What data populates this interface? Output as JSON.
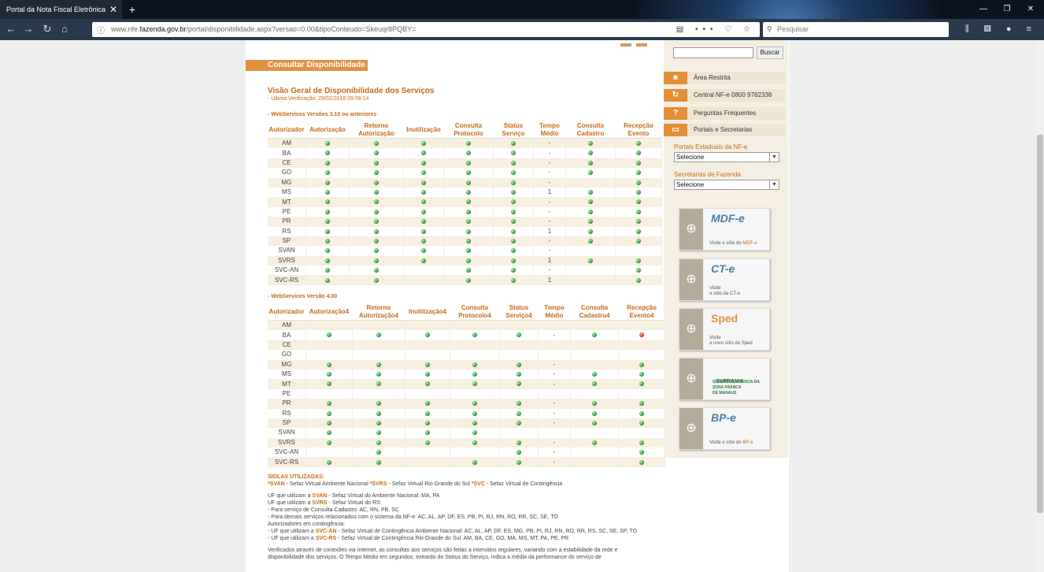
{
  "browser": {
    "tab_title": "Portal da Nota Fiscal Eletrônica",
    "url_prefix": "www.nfe.",
    "url_domain": "fazenda.gov.br",
    "url_rest": "/portal/disponibilidade.aspx?versao=0.00&tipoConteudo=Skeuqr8PQBY=",
    "search_placeholder": "Pesquisar"
  },
  "page": {
    "section_title": "Consultar Disponibilidade",
    "heading": "Visão Geral de Disponibilidade dos Serviços",
    "last_check": "- Última Verificação: 28/02/2018 09:59:14",
    "table1_title": "- WebServices Versões 3.10 ou anteriores",
    "table2_title": "- WebServices Versão 4.00",
    "table1_headers": [
      "Autorizador",
      "Autorização",
      "Retorno Autorização",
      "Inutilização",
      "Consulta Protocolo",
      "Status Serviço",
      "Tempo Médio",
      "Consulta Cadastro",
      "Recepção Evento"
    ],
    "table2_headers": [
      "Autorizador",
      "Autorização4",
      "Retorno Autorização4",
      "Inutilização4",
      "Consulta Protocolo4",
      "Status Serviço4",
      "Tempo Médio",
      "Consulta Cadastro4",
      "Recepção Evento4"
    ],
    "table1_rows": [
      [
        "AM",
        "g",
        "g",
        "g",
        "g",
        "g",
        "-",
        "g",
        "g"
      ],
      [
        "BA",
        "g",
        "g",
        "g",
        "g",
        "g",
        "-",
        "g",
        "g"
      ],
      [
        "CE",
        "g",
        "g",
        "g",
        "g",
        "g",
        "-",
        "g",
        "g"
      ],
      [
        "GO",
        "g",
        "g",
        "g",
        "g",
        "g",
        "-",
        "g",
        "g"
      ],
      [
        "MG",
        "g",
        "g",
        "g",
        "g",
        "g",
        "-",
        "",
        "g"
      ],
      [
        "MS",
        "g",
        "g",
        "g",
        "g",
        "g",
        "1",
        "g",
        "g"
      ],
      [
        "MT",
        "g",
        "g",
        "g",
        "g",
        "g",
        "-",
        "g",
        "g"
      ],
      [
        "PE",
        "g",
        "g",
        "g",
        "g",
        "g",
        "-",
        "g",
        "g"
      ],
      [
        "PR",
        "g",
        "g",
        "g",
        "g",
        "g",
        "-",
        "g",
        "g"
      ],
      [
        "RS",
        "g",
        "g",
        "g",
        "g",
        "g",
        "1",
        "g",
        "g"
      ],
      [
        "SP",
        "g",
        "g",
        "g",
        "g",
        "g",
        "-",
        "g",
        "g"
      ],
      [
        "SVAN",
        "g",
        "g",
        "g",
        "g",
        "g",
        "-",
        "",
        ""
      ],
      [
        "SVRS",
        "g",
        "g",
        "g",
        "g",
        "g",
        "1",
        "g",
        "g"
      ],
      [
        "SVC-AN",
        "g",
        "g",
        "",
        "g",
        "g",
        "-",
        "",
        "g"
      ],
      [
        "SVC-RS",
        "g",
        "g",
        "",
        "g",
        "g",
        "1",
        "",
        "g"
      ]
    ],
    "table2_rows": [
      [
        "AM",
        "",
        "",
        "",
        "",
        "",
        "",
        "",
        ""
      ],
      [
        "BA",
        "g",
        "g",
        "g",
        "g",
        "g",
        "-",
        "g",
        "r"
      ],
      [
        "CE",
        "",
        "",
        "",
        "",
        "",
        "",
        "",
        ""
      ],
      [
        "GO",
        "",
        "",
        "",
        "",
        "",
        "",
        "",
        ""
      ],
      [
        "MG",
        "g",
        "g",
        "g",
        "g",
        "g",
        "-",
        "",
        "g"
      ],
      [
        "MS",
        "g",
        "g",
        "g",
        "g",
        "g",
        "-",
        "g",
        "g"
      ],
      [
        "MT",
        "g",
        "g",
        "g",
        "g",
        "g",
        "-",
        "g",
        "g"
      ],
      [
        "PE",
        "",
        "",
        "",
        "",
        "",
        "",
        "",
        ""
      ],
      [
        "PR",
        "g",
        "g",
        "g",
        "g",
        "g",
        "-",
        "g",
        "g"
      ],
      [
        "RS",
        "g",
        "g",
        "g",
        "g",
        "g",
        "-",
        "g",
        "g"
      ],
      [
        "SP",
        "g",
        "g",
        "g",
        "g",
        "g",
        "-",
        "g",
        "g"
      ],
      [
        "SVAN",
        "g",
        "g",
        "g",
        "g",
        "",
        "",
        "",
        ""
      ],
      [
        "SVRS",
        "g",
        "g",
        "g",
        "g",
        "g",
        "-",
        "g",
        "g"
      ],
      [
        "SVC-AN",
        "",
        "g",
        "",
        "",
        "g",
        "-",
        "",
        "g"
      ],
      [
        "SVC-RS",
        "g",
        "g",
        "",
        "g",
        "g",
        "-",
        "",
        "g"
      ]
    ],
    "legend": {
      "title": "SIGLAS UTILIZADAS:",
      "line1_a": "*SVAN",
      "line1_b": " - Sefaz Virtual Ambiente Nacional ",
      "line1_c": "*SVRS",
      "line1_d": " - Sefaz Virtual Rio Grande do Sul ",
      "line1_e": "*SVC",
      "line1_f": " - Sefaz Virtual de Contingência",
      "uf1_a": "UF que utilizam a ",
      "uf1_b": "SVAN",
      "uf1_c": " - Sefaz Virtual do Ambiente Nacional: MA, PA",
      "uf2_a": "UF que utilizam a ",
      "uf2_b": "SVRS",
      "uf2_c": " - Sefaz Virtual do RS:",
      "uf3": "- Para serviço de Consulta Cadastro: AC, RN, PB, SC",
      "uf4": "- Para demais serviços relacionados com o sistema da NF-e: AC, AL, AP, DF, ES, PB, PI, RJ, RN, RO, RR, SC, SE, TO",
      "uf5": "Autorizadores em contingência:",
      "uf6_a": "- UF que utilizam a ",
      "uf6_b": "SVC-AN",
      "uf6_c": " - Sefaz Virtual de Contingência Ambiente Nacional: AC, AL, AP, DF, ES, MG, PB, PI, RJ, RN, RO, RR, RS, SC, SE, SP, TO",
      "uf7_a": "- UF que utilizam a ",
      "uf7_b": "SVC-RS",
      "uf7_c": " - Sefaz Virtual de Contingência Rio Grande do Sul: AM, BA, CE, GO, MA, MS, MT, PA, PE, PR",
      "verif1": "Verificados através de conexões via Internet, as consultas aos serviços são feitas a intervalos regulares, variando com a estabilidade da rede e",
      "verif2": "disponibilidade dos serviços. O Tempo Médio em segundos, extraído do Status do Serviço, indica a média da performance do serviço de"
    }
  },
  "sidebar": {
    "search_button": "Buscar",
    "links": [
      "Área Restrita",
      "Central NF-e 0800 9782338",
      "Perguntas Frequentes",
      "Portais e Secretarias"
    ],
    "portais_label": "Portais Estaduais da NF-e",
    "portais_select": "Selecione",
    "secretarias_label": "Secretarias de Fazenda",
    "secretarias_select": "Selecione",
    "banners": [
      {
        "logo": "MDF-e",
        "t1": "Visite o sítio do ",
        "t2": "MDF-e"
      },
      {
        "logo": "CT-e",
        "t1": "Visite",
        "t2": "o sítio da CT-e"
      },
      {
        "logo": "Sped",
        "t1": "Visite",
        "t2": "o novo sítio do Sped"
      },
      {
        "logo": "SUFRAMA",
        "t1": "SUPERINTENDÊNCIA DA ZONA FRANCA",
        "t2": "DE MANAUS"
      },
      {
        "logo": "BP-e",
        "t1": "Visite o sítio do ",
        "t2": "BP-e"
      }
    ]
  },
  "colors": {
    "accent": "#e0913f",
    "heading": "#c46a14",
    "status_ok": "#2e9a3a",
    "status_error": "#e03a1a"
  }
}
